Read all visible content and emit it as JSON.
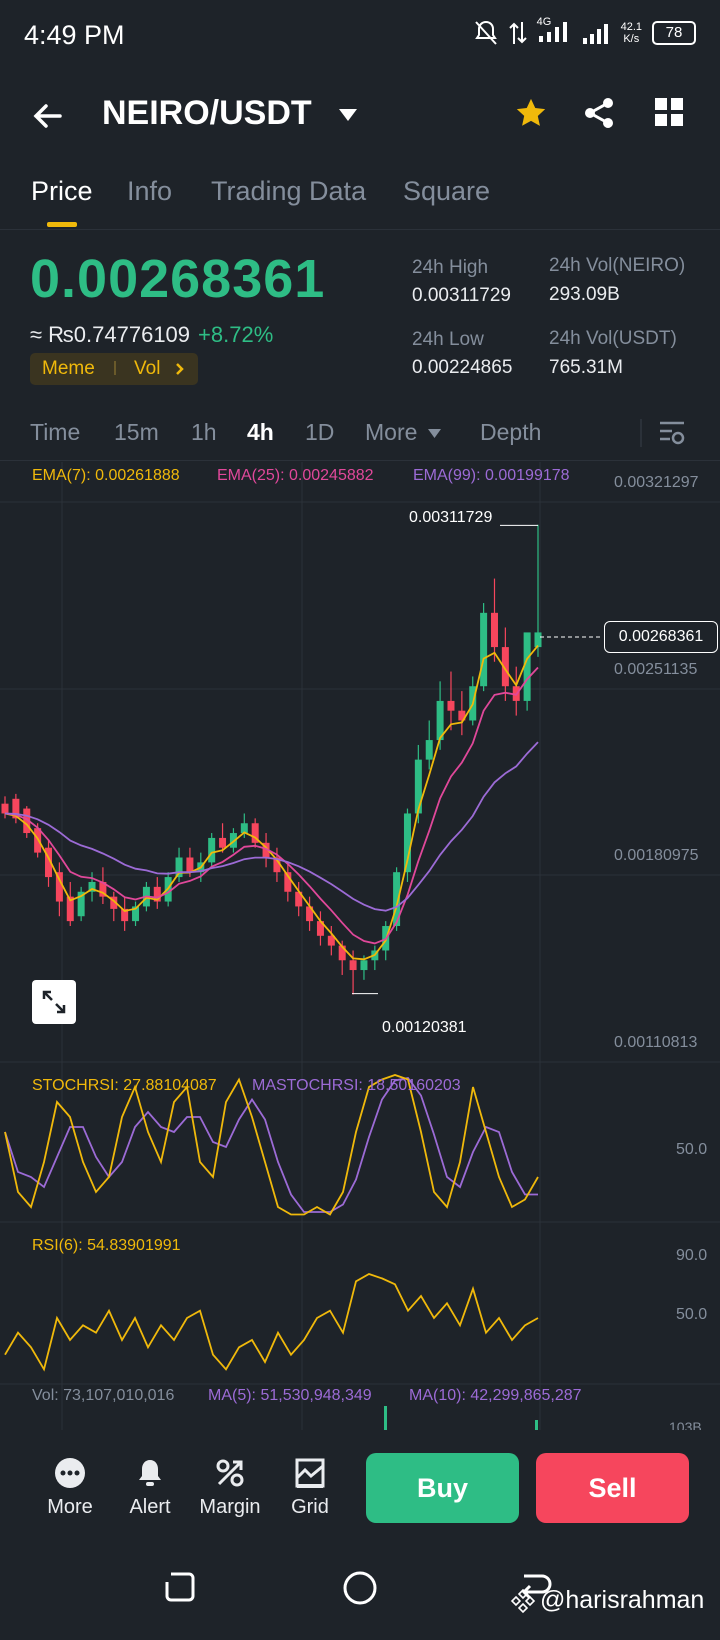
{
  "status": {
    "time": "4:49 PM",
    "network": "4G",
    "speed_top": "42.1",
    "speed_bottom": "K/s",
    "battery": "78"
  },
  "header": {
    "pair": "NEIRO/USDT"
  },
  "tabs": [
    {
      "label": "Price"
    },
    {
      "label": "Info"
    },
    {
      "label": "Trading Data"
    },
    {
      "label": "Square"
    }
  ],
  "ticker": {
    "last_price": "0.00268361",
    "fiat_price": "≈ ₨0.74776109",
    "change": "+8.72%",
    "tag_meme": "Meme",
    "tag_vol": "Vol",
    "high_label": "24h High",
    "high_value": "0.00311729",
    "low_label": "24h Low",
    "low_value": "0.00224865",
    "vol_base_label": "24h Vol(NEIRO)",
    "vol_base_value": "293.09B",
    "vol_quote_label": "24h Vol(USDT)",
    "vol_quote_value": "765.31M"
  },
  "intervals": [
    {
      "label": "Time"
    },
    {
      "label": "15m"
    },
    {
      "label": "1h"
    },
    {
      "label": "4h"
    },
    {
      "label": "1D"
    },
    {
      "label": "More"
    },
    {
      "label": "Depth"
    }
  ],
  "selected_interval": "4h",
  "indicators": {
    "ema7": "EMA(7): 0.00261888",
    "ema25": "EMA(25): 0.00245882",
    "ema99": "EMA(99): 0.00199178",
    "stochrsi": "STOCHRSI: 27.88104087",
    "mastochrsi": "MASTOCHRSI: 18.50160203",
    "rsi": "RSI(6): 54.83901991",
    "vol": "Vol: 73,107,010,016",
    "vol_ma5": "MA(5): 51,530,948,349",
    "vol_ma10": "MA(10): 42,299,865,287"
  },
  "price_axis": [
    "0.00321297",
    "0.00251135",
    "0.00180975",
    "0.00110813"
  ],
  "price_tag": "0.00268361",
  "high_marker": "0.00311729",
  "low_marker": "0.00120381",
  "stoch_axis": "50.0",
  "rsi_axis_top": "90.0",
  "rsi_axis_mid": "50.0",
  "vol_axis": "103B",
  "colors": {
    "up": "#2ebd85",
    "down": "#f6465d",
    "ema7": "#f0b90b",
    "ema25": "#e0489a",
    "ema99": "#9c6bd6",
    "accent": "#f0b90b"
  },
  "chart_data": {
    "type": "candlestick",
    "interval": "4h",
    "y_range": [
      0.00110813,
      0.00321297
    ],
    "candles": [
      [
        0.00198,
        0.00201,
        0.00194,
        0.00192
      ],
      [
        0.002,
        0.00202,
        0.00192,
        0.0019
      ],
      [
        0.00196,
        0.00197,
        0.00186,
        0.00184
      ],
      [
        0.00188,
        0.0019,
        0.00178,
        0.00176
      ],
      [
        0.0018,
        0.00183,
        0.00168,
        0.00164
      ],
      [
        0.0017,
        0.00174,
        0.00158,
        0.00152
      ],
      [
        0.0016,
        0.00166,
        0.0015,
        0.00148
      ],
      [
        0.00152,
        0.00164,
        0.00162,
        0.0015
      ],
      [
        0.00162,
        0.0017,
        0.00166,
        0.00158
      ],
      [
        0.00166,
        0.00172,
        0.0016,
        0.00157
      ],
      [
        0.0016,
        0.00162,
        0.00155,
        0.0015
      ],
      [
        0.00155,
        0.0016,
        0.0015,
        0.00146
      ],
      [
        0.0015,
        0.00158,
        0.00156,
        0.00148
      ],
      [
        0.00156,
        0.00166,
        0.00164,
        0.00154
      ],
      [
        0.00164,
        0.00168,
        0.00158,
        0.00155
      ],
      [
        0.00158,
        0.0017,
        0.00168,
        0.00156
      ],
      [
        0.00168,
        0.0018,
        0.00176,
        0.00166
      ],
      [
        0.00176,
        0.0018,
        0.0017,
        0.00168
      ],
      [
        0.0017,
        0.00178,
        0.00174,
        0.00166
      ],
      [
        0.00174,
        0.00186,
        0.00184,
        0.00172
      ],
      [
        0.00184,
        0.0019,
        0.0018,
        0.00178
      ],
      [
        0.0018,
        0.00188,
        0.00186,
        0.00178
      ],
      [
        0.00186,
        0.00194,
        0.0019,
        0.00184
      ],
      [
        0.0019,
        0.00192,
        0.00182,
        0.0018
      ],
      [
        0.00182,
        0.00186,
        0.00176,
        0.00172
      ],
      [
        0.00176,
        0.0018,
        0.0017,
        0.00166
      ],
      [
        0.0017,
        0.00174,
        0.00162,
        0.00158
      ],
      [
        0.00162,
        0.00166,
        0.00156,
        0.00152
      ],
      [
        0.00156,
        0.0016,
        0.0015,
        0.00146
      ],
      [
        0.0015,
        0.00154,
        0.00144,
        0.0014
      ],
      [
        0.00144,
        0.00148,
        0.0014,
        0.00136
      ],
      [
        0.0014,
        0.00142,
        0.00134,
        0.00128
      ],
      [
        0.00134,
        0.00138,
        0.0013,
        0.0012
      ],
      [
        0.0013,
        0.00136,
        0.00134,
        0.00126
      ],
      [
        0.00134,
        0.0014,
        0.00138,
        0.0013
      ],
      [
        0.00138,
        0.0015,
        0.00148,
        0.00134
      ],
      [
        0.00148,
        0.00172,
        0.0017,
        0.00146
      ],
      [
        0.0017,
        0.00196,
        0.00194,
        0.00166
      ],
      [
        0.00194,
        0.00222,
        0.00216,
        0.0019
      ],
      [
        0.00216,
        0.00232,
        0.00224,
        0.00212
      ],
      [
        0.00224,
        0.00248,
        0.0024,
        0.0022
      ],
      [
        0.0024,
        0.00252,
        0.00236,
        0.00228
      ],
      [
        0.00236,
        0.00244,
        0.00232,
        0.00226
      ],
      [
        0.00232,
        0.0025,
        0.00246,
        0.0023
      ],
      [
        0.00246,
        0.0028,
        0.00276,
        0.00244
      ],
      [
        0.00276,
        0.0029,
        0.00262,
        0.00256
      ],
      [
        0.00262,
        0.0027,
        0.00246,
        0.0024
      ],
      [
        0.00246,
        0.00254,
        0.0024,
        0.00234
      ],
      [
        0.0024,
        0.00258,
        0.00268,
        0.00236
      ],
      [
        0.00262,
        0.00312,
        0.00268,
        0.00258
      ]
    ]
  }
}
